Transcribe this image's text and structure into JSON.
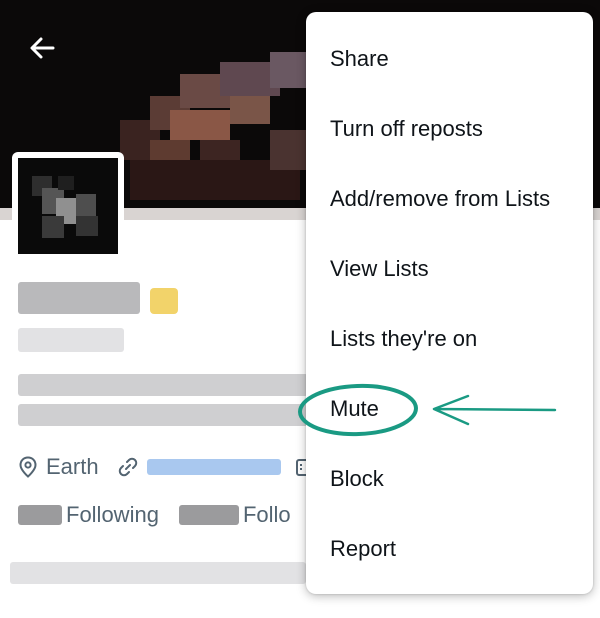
{
  "header": {
    "back_icon": "arrow-left-icon"
  },
  "profile": {
    "location": "Earth",
    "location_icon": "map-pin-icon",
    "link_icon": "link-icon",
    "calendar_icon": "calendar-icon",
    "verified_badge_color": "#f2d36a",
    "link_color": "#1d9bf0"
  },
  "stats": {
    "following_label": "Following",
    "followers_label_partial": "Follo"
  },
  "menu": {
    "items": [
      {
        "label": "Share"
      },
      {
        "label": "Turn off reposts"
      },
      {
        "label": "Add/remove from Lists"
      },
      {
        "label": "View Lists"
      },
      {
        "label": "Lists they're on"
      },
      {
        "label": "Mute"
      },
      {
        "label": "Block"
      },
      {
        "label": "Report"
      }
    ]
  },
  "annotation": {
    "highlight_color": "#1a9a83",
    "highlighted_item": "Mute"
  }
}
